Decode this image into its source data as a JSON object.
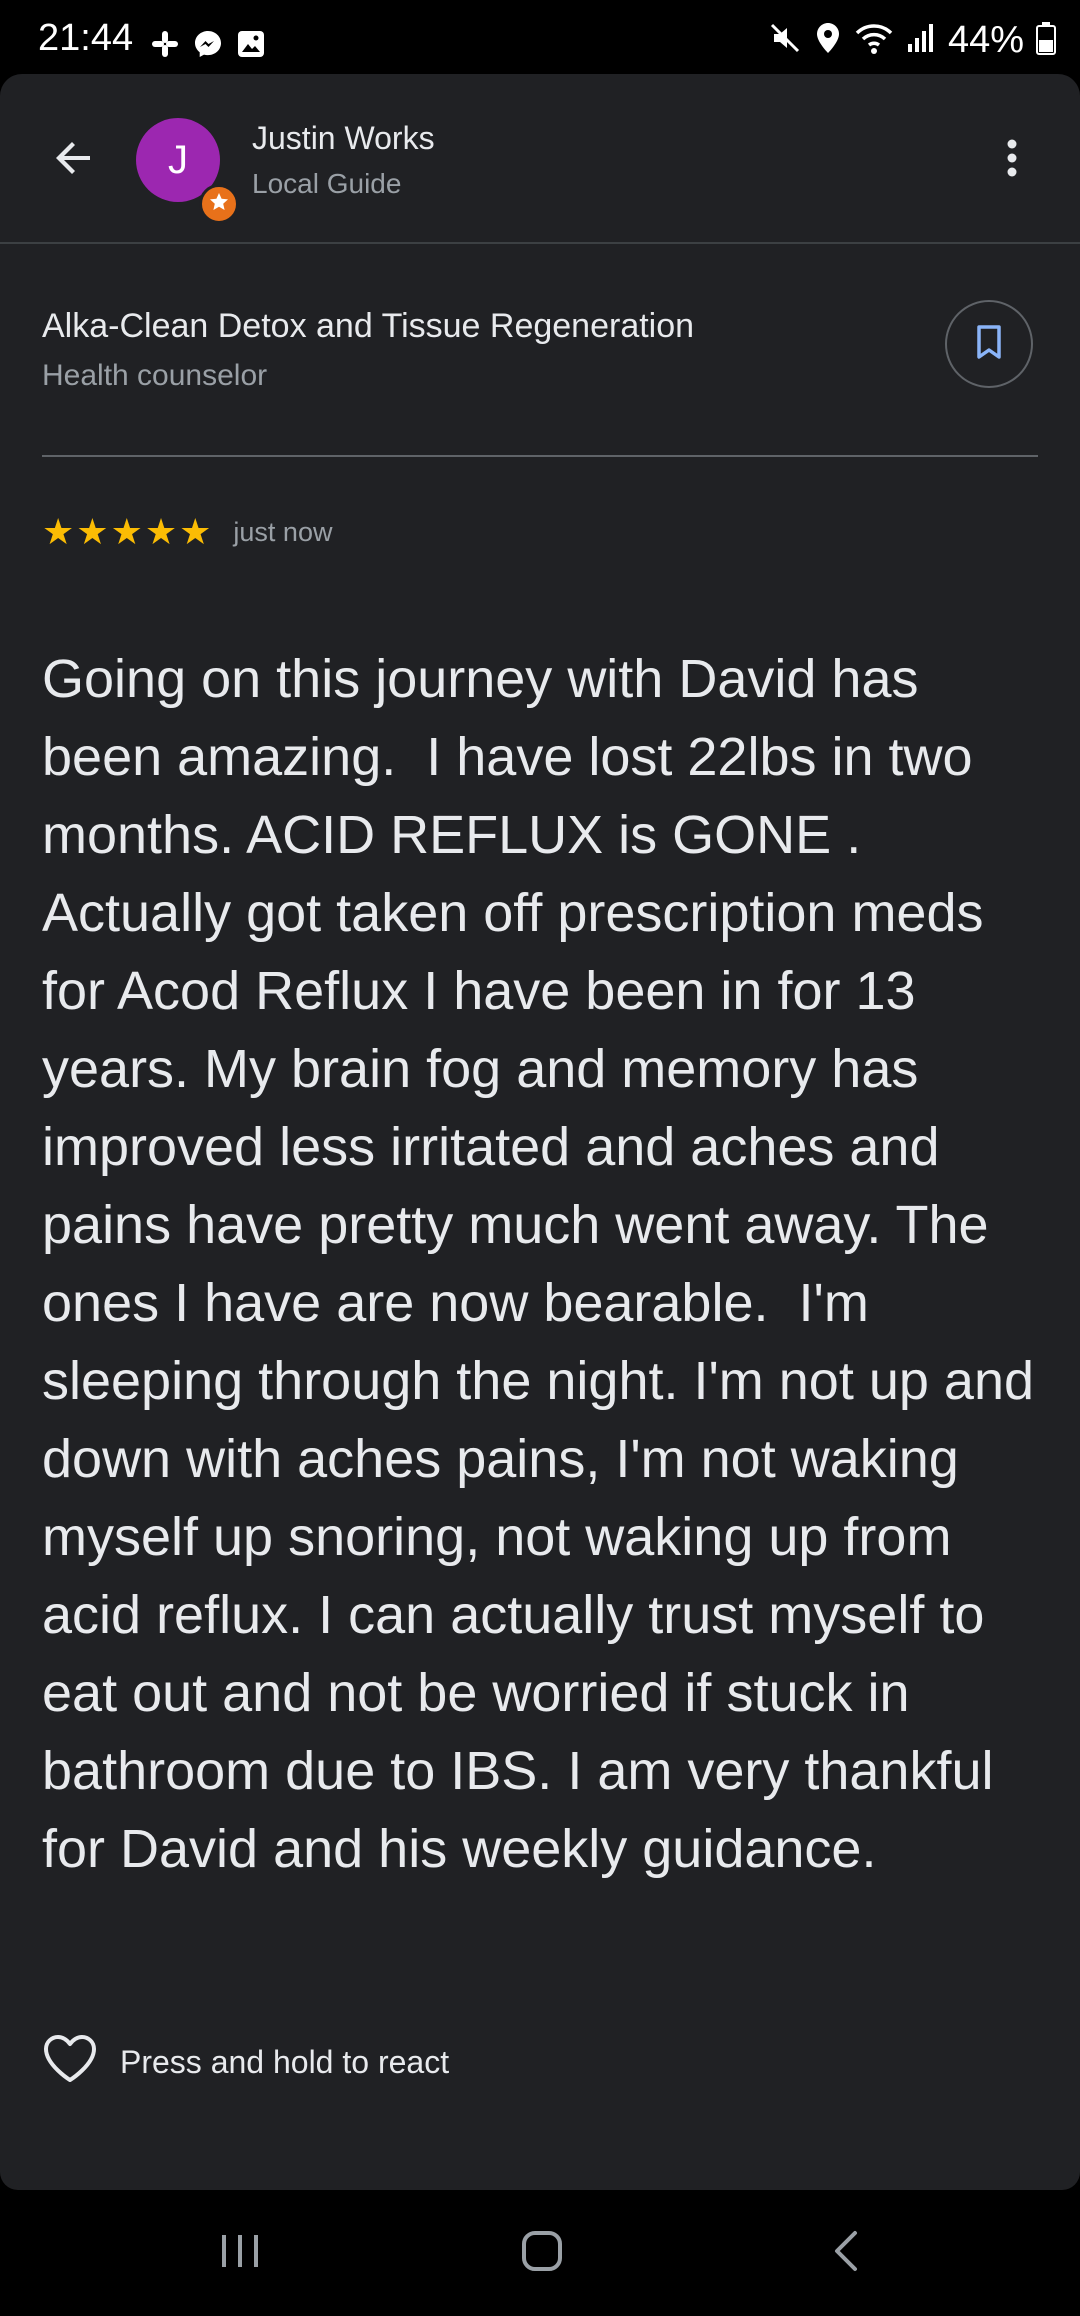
{
  "status_bar": {
    "time": "21:44",
    "battery": "44%",
    "left_icons": [
      "slack-icon",
      "messenger-icon",
      "gallery-icon"
    ],
    "right_icons": [
      "mute-icon",
      "location-icon",
      "wifi-icon",
      "signal-icon",
      "battery-icon"
    ]
  },
  "header": {
    "avatar_letter": "J",
    "reviewer_name": "Justin Works",
    "reviewer_subtitle": "Local Guide"
  },
  "place": {
    "name": "Alka-Clean Detox and Tissue Regeneration",
    "category": "Health counselor"
  },
  "review": {
    "rating": 5,
    "time_ago": "just now",
    "text": "Going on this journey with David has been amazing.  I have lost 22lbs in two months. ACID REFLUX is GONE . Actually got taken off prescription meds for Acod Reflux I have been in for 13 years. My brain fog and memory has improved less irritated and aches and pains have pretty much went away. The ones I have are now bearable.  I'm sleeping through the night. I'm not up and down with aches pains, I'm not waking myself up snoring, not waking up from acid reflux. I can actually trust myself to eat out and not be worried if stuck in bathroom due to IBS. I am very thankful for David and his weekly guidance."
  },
  "reaction": {
    "label": "Press and hold to react"
  },
  "colors": {
    "background": "#202124",
    "star": "#fbbc04",
    "avatar": "#9c27b0",
    "badge": "#e8711a",
    "save_icon": "#8ab4f8"
  }
}
